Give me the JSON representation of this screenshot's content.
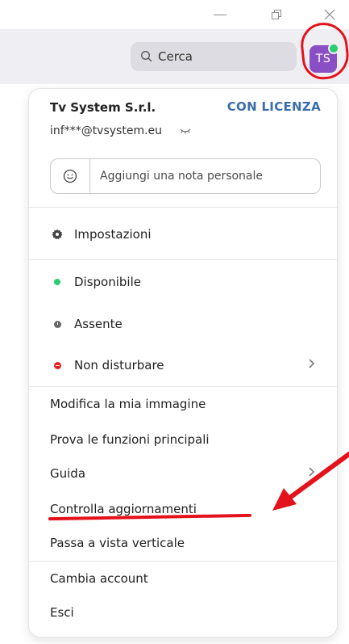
{
  "window_controls": {
    "minimize": "minimize-icon",
    "restore": "restore-icon",
    "close": "close-icon"
  },
  "header": {
    "search_label": "Cerca",
    "avatar_initials": "TS",
    "avatar_color": "#8a4fc5",
    "presence_color": "#2ecc71"
  },
  "account": {
    "name": "Tv System S.r.l.",
    "license": "CON LICENZA",
    "email": "inf***@tvsystem.eu"
  },
  "note": {
    "placeholder": "Aggiungi una nota personale"
  },
  "menu": {
    "settings": "Impostazioni",
    "status": {
      "available": "Disponibile",
      "away": "Assente",
      "dnd": "Non disturbare"
    },
    "profile_picture": "Modifica la mia immagine",
    "try_features": "Prova le funzioni principali",
    "help": "Guida",
    "check_updates": "Controlla aggiornamenti",
    "vertical_view": "Passa a vista verticale",
    "switch_account": "Cambia account",
    "sign_out": "Esci"
  },
  "colors": {
    "accent_license": "#3b6ea8",
    "annotation": "#e3121b",
    "dnd": "#e02424"
  }
}
